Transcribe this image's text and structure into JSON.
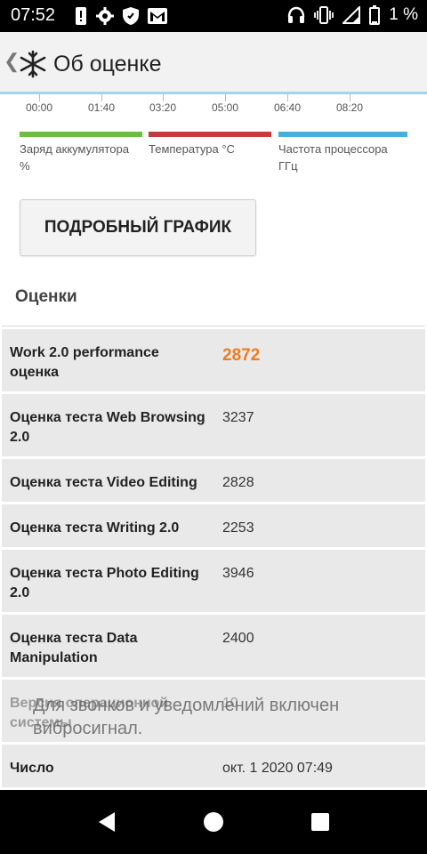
{
  "status_bar": {
    "time": "07:52",
    "battery_percent": "1 %"
  },
  "app_bar": {
    "title": "Об оценке"
  },
  "timeline": {
    "ticks": [
      "00:00",
      "01:40",
      "03:20",
      "05:00",
      "06:40",
      "08:20"
    ]
  },
  "legend": [
    {
      "label": "Заряд аккумулятора %",
      "color": "#6abf3c"
    },
    {
      "label": "Температура °C",
      "color": "#c9383a"
    },
    {
      "label": "Частота процессора ГГц",
      "color": "#45b0e0"
    }
  ],
  "detail_button": {
    "label": "ПОДРОБНЫЙ ГРАФИК"
  },
  "scores": {
    "title": "Оценки",
    "rows": [
      {
        "label": "Work 2.0 performance оценка",
        "value": "2872"
      },
      {
        "label": "Оценка теста Web Browsing 2.0",
        "value": "3237"
      },
      {
        "label": "Оценка теста Video Editing",
        "value": "2828"
      },
      {
        "label": "Оценка теста Writing 2.0",
        "value": "2253"
      },
      {
        "label": "Оценка теста Photo Editing 2.0",
        "value": "3946"
      },
      {
        "label": "Оценка теста Data Manipulation",
        "value": "2400"
      },
      {
        "label": "Версия операционной системы",
        "value": "10"
      },
      {
        "label": "Число",
        "value": "окт. 1 2020 07:49"
      }
    ]
  },
  "toast": {
    "text": "Для звонков и уведомлений включен вибросигнал."
  },
  "colors": {
    "accent": "#f07c1e",
    "row_bg": "#e9e9e9",
    "appbar_border": "#9ed6ee"
  }
}
